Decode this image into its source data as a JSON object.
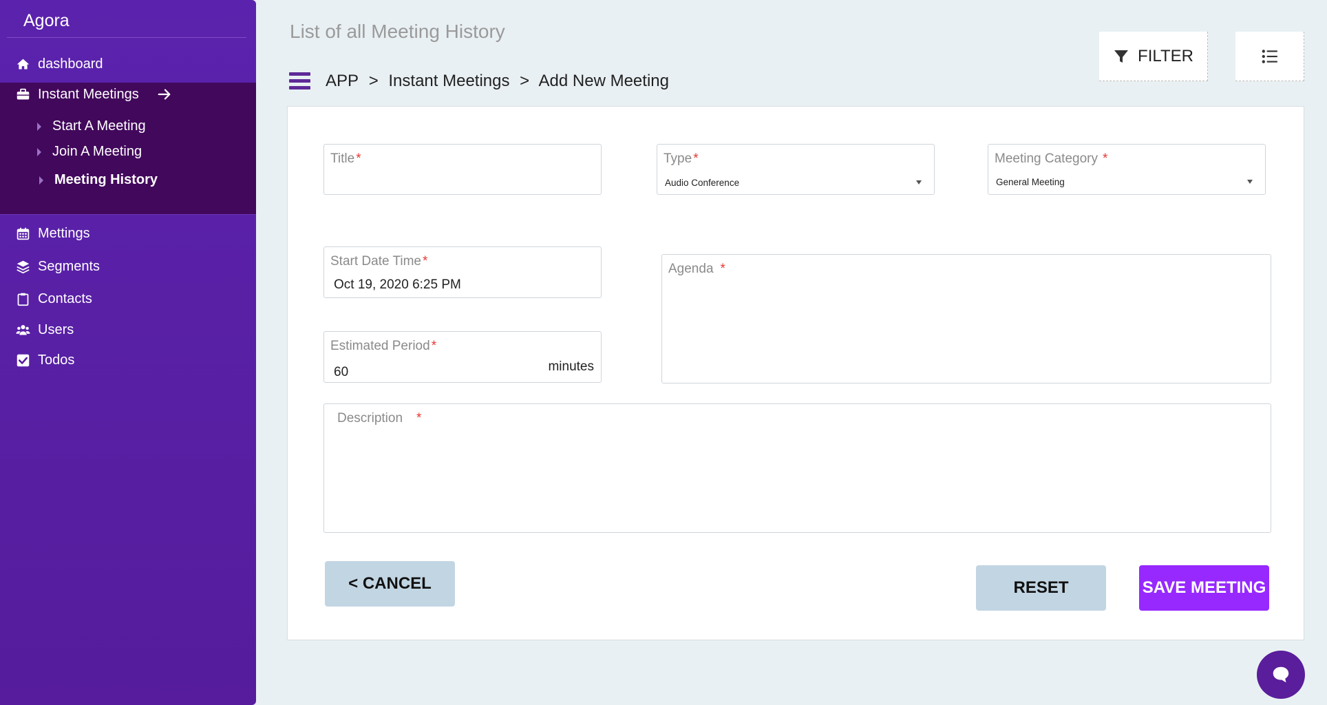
{
  "sidebar": {
    "brand": "Agora",
    "items": [
      {
        "label": "dashboard",
        "icon": "home-icon"
      },
      {
        "label": "Instant Meetings",
        "icon": "briefcase-icon"
      },
      {
        "label": "Mettings",
        "icon": "calendar-icon"
      },
      {
        "label": "Segments",
        "icon": "layers-icon"
      },
      {
        "label": "Contacts",
        "icon": "clipboard-icon"
      },
      {
        "label": "Users",
        "icon": "users-icon"
      },
      {
        "label": "Todos",
        "icon": "checkbox-icon"
      }
    ],
    "sub_items": [
      {
        "label": "Start A Meeting"
      },
      {
        "label": "Join A Meeting"
      },
      {
        "label": "Meeting History",
        "active": true
      }
    ]
  },
  "header": {
    "title": "List of all Meeting History",
    "breadcrumb": [
      "APP",
      ">",
      "Instant Meetings",
      ">",
      "Add New Meeting"
    ],
    "filter_label": "FILTER"
  },
  "form": {
    "title": {
      "label": "Title",
      "required": "*",
      "value": ""
    },
    "type": {
      "label": "Type",
      "required": "*",
      "value": "Audio Conference"
    },
    "category": {
      "label": "Meeting Category",
      "required": "*",
      "value": "General Meeting"
    },
    "start": {
      "label": "Start Date Time",
      "required": "*",
      "value": "Oct 19, 2020 6:25 PM"
    },
    "period": {
      "label": "Estimated Period",
      "required": "*",
      "value": "60",
      "suffix": "minutes"
    },
    "agenda": {
      "label": "Agenda",
      "required": "*"
    },
    "description": {
      "label": "Description",
      "required": "*"
    }
  },
  "actions": {
    "cancel": "< CANCEL",
    "reset": "RESET",
    "save": "SAVE MEETING"
  },
  "colors": {
    "sidebar": "#5b23ad",
    "sidebar_active": "#42085c",
    "primary_button": "#9729ff",
    "secondary_button": "#c2d5e3",
    "required": "#e53935"
  }
}
